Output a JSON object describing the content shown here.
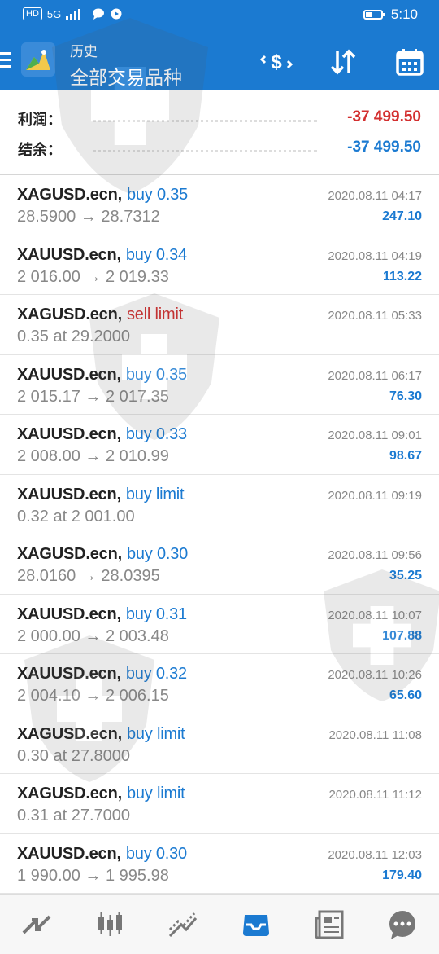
{
  "status_bar": {
    "network_badge": "HD",
    "signal_text": "5G",
    "time": "5:10"
  },
  "header": {
    "subtitle": "历史",
    "title": "全部交易品种",
    "actions": [
      "currency-exchange-icon",
      "sort-icon",
      "calendar-icon"
    ]
  },
  "summary": {
    "profit_label": "利润：",
    "profit_value": "-37 499.50",
    "balance_label": "结余：",
    "balance_value": "-37 499.50"
  },
  "colors": {
    "accent": "#1b7ad1",
    "loss": "#d32f2f",
    "muted": "#888888"
  },
  "trades": [
    {
      "symbol": "XAGUSD.ecn,",
      "side": "buy 0.35",
      "side_type": "buy",
      "detail": "28.5900 → 28.7312",
      "date": "2020.08.11 04:17",
      "profit": "247.10"
    },
    {
      "symbol": "XAUUSD.ecn,",
      "side": "buy 0.34",
      "side_type": "buy",
      "detail": "2 016.00 → 2 019.33",
      "date": "2020.08.11 04:19",
      "profit": "113.22"
    },
    {
      "symbol": "XAGUSD.ecn,",
      "side": "sell limit",
      "side_type": "sell",
      "detail": "0.35 at 29.2000",
      "date": "2020.08.11 05:33",
      "profit": ""
    },
    {
      "symbol": "XAUUSD.ecn,",
      "side": "buy 0.35",
      "side_type": "buy",
      "detail": "2 015.17 → 2 017.35",
      "date": "2020.08.11 06:17",
      "profit": "76.30"
    },
    {
      "symbol": "XAUUSD.ecn,",
      "side": "buy 0.33",
      "side_type": "buy",
      "detail": "2 008.00 → 2 010.99",
      "date": "2020.08.11 09:01",
      "profit": "98.67"
    },
    {
      "symbol": "XAUUSD.ecn,",
      "side": "buy limit",
      "side_type": "buy",
      "detail": "0.32 at 2 001.00",
      "date": "2020.08.11 09:19",
      "profit": ""
    },
    {
      "symbol": "XAGUSD.ecn,",
      "side": "buy 0.30",
      "side_type": "buy",
      "detail": "28.0160 → 28.0395",
      "date": "2020.08.11 09:56",
      "profit": "35.25"
    },
    {
      "symbol": "XAUUSD.ecn,",
      "side": "buy 0.31",
      "side_type": "buy",
      "detail": "2 000.00 → 2 003.48",
      "date": "2020.08.11 10:07",
      "profit": "107.88"
    },
    {
      "symbol": "XAUUSD.ecn,",
      "side": "buy 0.32",
      "side_type": "buy",
      "detail": "2 004.10 → 2 006.15",
      "date": "2020.08.11 10:26",
      "profit": "65.60"
    },
    {
      "symbol": "XAGUSD.ecn,",
      "side": "buy limit",
      "side_type": "buy",
      "detail": "0.30 at 27.8000",
      "date": "2020.08.11 11:08",
      "profit": ""
    },
    {
      "symbol": "XAGUSD.ecn,",
      "side": "buy limit",
      "side_type": "buy",
      "detail": "0.31 at 27.7000",
      "date": "2020.08.11 11:12",
      "profit": ""
    },
    {
      "symbol": "XAUUSD.ecn,",
      "side": "buy 0.30",
      "side_type": "buy",
      "detail": "1 990.00 → 1 995.98",
      "date": "2020.08.11 12:03",
      "profit": "179.40"
    }
  ],
  "bottom_nav": [
    {
      "icon": "quotes-icon",
      "active": false
    },
    {
      "icon": "chart-icon",
      "active": false
    },
    {
      "icon": "trade-icon",
      "active": false
    },
    {
      "icon": "history-icon",
      "active": true
    },
    {
      "icon": "news-icon",
      "active": false
    },
    {
      "icon": "chat-icon",
      "active": false
    }
  ]
}
